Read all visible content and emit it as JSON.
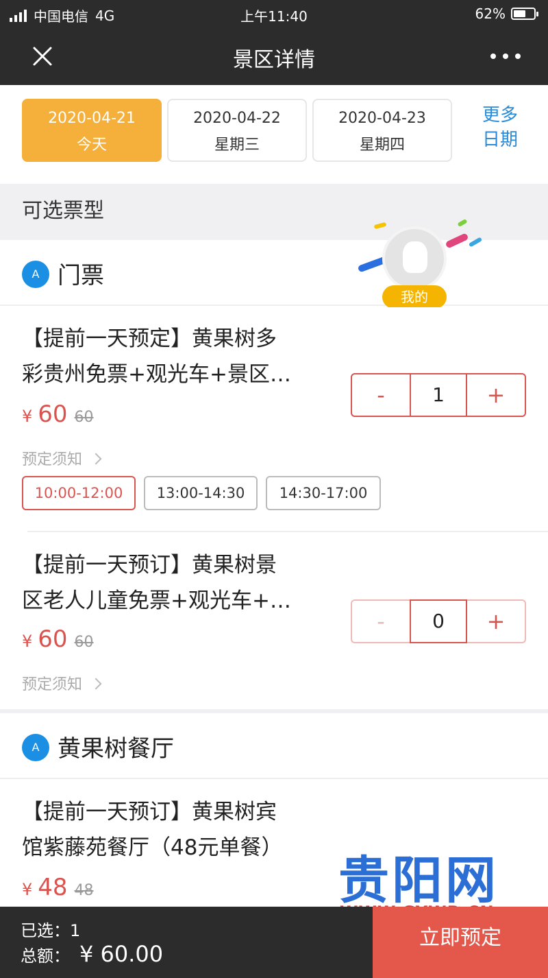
{
  "status": {
    "carrier": "中国电信",
    "network": "4G",
    "time": "上午11:40",
    "battery": "62%",
    "battery_level": 0.62
  },
  "nav": {
    "title": "景区详情",
    "close_icon": "close-icon",
    "more_icon": "more-dots-icon"
  },
  "dates": [
    {
      "date": "2020-04-21",
      "weekday": "今天",
      "selected": true
    },
    {
      "date": "2020-04-22",
      "weekday": "星期三",
      "selected": false
    },
    {
      "date": "2020-04-23",
      "weekday": "星期四",
      "selected": false
    }
  ],
  "more_dates": {
    "line1": "更多",
    "line2": "日期"
  },
  "section": {
    "title": "可选票型"
  },
  "floating": {
    "label": "我的"
  },
  "groups": [
    {
      "title": "门票",
      "badge": "A",
      "items": [
        {
          "name_line1": "【提前一天预定】黄果树多",
          "name_line2": "彩贵州免票+观光车+景区…",
          "currency": "¥",
          "price": "60",
          "original_price": "60",
          "notice": "预定须知",
          "quantity": "1",
          "minus": "-",
          "plus": "+",
          "slots": [
            {
              "label": "10:00-12:00",
              "selected": true
            },
            {
              "label": "13:00-14:30",
              "selected": false
            },
            {
              "label": "14:30-17:00",
              "selected": false
            }
          ]
        },
        {
          "name_line1": "【提前一天预订】黄果树景",
          "name_line2": "区老人儿童免票+观光车+…",
          "currency": "¥",
          "price": "60",
          "original_price": "60",
          "notice": "预定须知",
          "quantity": "0",
          "minus": "-",
          "plus": "+"
        }
      ]
    },
    {
      "title": "黄果树餐厅",
      "badge": "A",
      "items": [
        {
          "name_line1": "【提前一天预订】黄果树宾",
          "name_line2": "馆紫藤苑餐厅（48元单餐）",
          "currency": "¥",
          "price": "48",
          "original_price": "48"
        }
      ]
    }
  ],
  "watermark": {
    "logo": "贵阳网",
    "url": "WWW.GYWB.CN"
  },
  "footer": {
    "selected_label": "已选：",
    "selected_count": "1",
    "total_label": "总额：",
    "total_amount": "¥ 60.00",
    "book_label": "立即预定"
  },
  "colors": {
    "accent_orange": "#f4b03a",
    "price_red": "#d9534f",
    "link_blue": "#2a8ad8",
    "badge_blue": "#1a8fe3",
    "book_button": "#e4584b",
    "bar_dark": "#2c2c2c"
  }
}
